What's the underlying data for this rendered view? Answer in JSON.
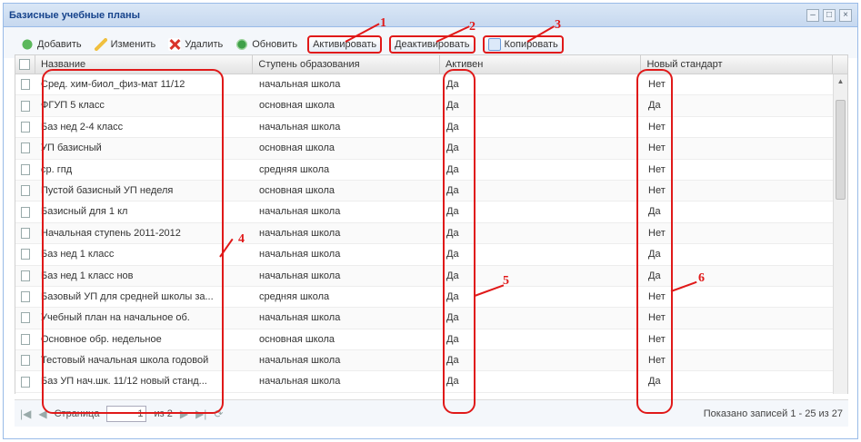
{
  "window": {
    "title": "Базисные учебные планы",
    "tools": [
      "–",
      "□",
      "×"
    ]
  },
  "toolbar": {
    "add": "Добавить",
    "edit": "Изменить",
    "delete": "Удалить",
    "refresh": "Обновить",
    "activate": "Активировать",
    "deactivate": "Деактивировать",
    "copy": "Копировать"
  },
  "grid": {
    "columns": [
      "Название",
      "Ступень образования",
      "Активен",
      "Новый стандарт"
    ],
    "rows": [
      [
        "Сред. хим-биол_физ-мат 11/12",
        "начальная школа",
        "Да",
        "Нет"
      ],
      [
        "ФГУП 5 класс",
        "основная школа",
        "Да",
        "Да"
      ],
      [
        "Баз нед 2-4 класс",
        "начальная школа",
        "Да",
        "Нет"
      ],
      [
        "УП базисный",
        "основная школа",
        "Да",
        "Нет"
      ],
      [
        "ср. гпд",
        "средняя школа",
        "Да",
        "Нет"
      ],
      [
        "Пустой базисный УП неделя",
        "основная школа",
        "Да",
        "Нет"
      ],
      [
        "Базисный для 1 кл",
        "начальная школа",
        "Да",
        "Да"
      ],
      [
        "Начальная ступень 2011-2012",
        "начальная школа",
        "Да",
        "Нет"
      ],
      [
        "Баз нед 1 класс",
        "начальная школа",
        "Да",
        "Да"
      ],
      [
        "Баз нед 1 класс нов",
        "начальная школа",
        "Да",
        "Да"
      ],
      [
        "Базовый УП для средней школы за...",
        "средняя школа",
        "Да",
        "Нет"
      ],
      [
        "Учебный план на начальное об.",
        "начальная школа",
        "Да",
        "Нет"
      ],
      [
        "Основное обр. недельное",
        "основная школа",
        "Да",
        "Нет"
      ],
      [
        "Тестовый начальная школа годовой",
        "начальная школа",
        "Да",
        "Нет"
      ],
      [
        "Баз УП нач.шк. 11/12 новый станд...",
        "начальная школа",
        "Да",
        "Да"
      ]
    ]
  },
  "pager": {
    "page_label": "Страница",
    "page_value": "1",
    "of_label": "из 2",
    "status": "Показано записей 1 - 25 из 27"
  },
  "annotations": [
    "1",
    "2",
    "3",
    "4",
    "5",
    "6"
  ]
}
